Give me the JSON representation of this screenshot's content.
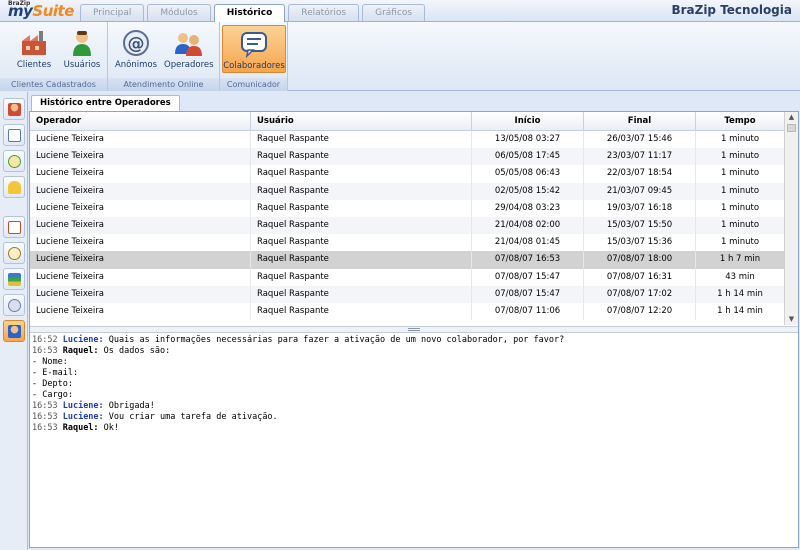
{
  "app": {
    "logo_brazip": "BraZip",
    "logo_my": "my",
    "logo_suite": "Suite",
    "brand": "BraZip Tecnologia"
  },
  "tabs": [
    {
      "label": "Principal",
      "active": false
    },
    {
      "label": "Módulos",
      "active": false
    },
    {
      "label": "Histórico",
      "active": true
    },
    {
      "label": "Relatórios",
      "active": false
    },
    {
      "label": "Gráficos",
      "active": false
    }
  ],
  "ribbon": {
    "groups": [
      {
        "label": "Clientes Cadastrados",
        "buttons": [
          {
            "label": "Clientes",
            "icon": "factory-icon"
          },
          {
            "label": "Usuários",
            "icon": "user-icon"
          }
        ]
      },
      {
        "label": "Atendimento Online",
        "buttons": [
          {
            "label": "Anônimos",
            "icon": "at-sign-icon"
          },
          {
            "label": "Operadores",
            "icon": "operators-icon"
          }
        ]
      },
      {
        "label": "Comunicador",
        "buttons": [
          {
            "label": "Colaboradores",
            "icon": "chat-bubble-icon",
            "active": true
          }
        ]
      }
    ]
  },
  "sidebar_icons": [
    "user-history-icon",
    "add-document-icon",
    "scheduled-add-icon",
    "bell-icon",
    "note-edit-icon",
    "clock-icon",
    "books-icon",
    "chat-users-icon",
    "collaborator-icon"
  ],
  "panel": {
    "tab_label": "Histórico entre Operadores"
  },
  "grid": {
    "columns": [
      "Operador",
      "Usuário",
      "Início",
      "Final",
      "Tempo"
    ],
    "rows": [
      [
        "Luciene Teixeira",
        "Raquel Raspante",
        "13/05/08 03:27",
        "26/03/07 15:46",
        "1 minuto"
      ],
      [
        "Luciene Teixeira",
        "Raquel Raspante",
        "06/05/08 17:45",
        "23/03/07 11:17",
        "1 minuto"
      ],
      [
        "Luciene Teixeira",
        "Raquel Raspante",
        "05/05/08 06:43",
        "22/03/07 18:54",
        "1 minuto"
      ],
      [
        "Luciene Teixeira",
        "Raquel Raspante",
        "02/05/08 15:42",
        "21/03/07 09:45",
        "1 minuto"
      ],
      [
        "Luciene Teixeira",
        "Raquel Raspante",
        "29/04/08 03:23",
        "19/03/07 16:18",
        "1 minuto"
      ],
      [
        "Luciene Teixeira",
        "Raquel Raspante",
        "21/04/08 02:00",
        "15/03/07 15:50",
        "1 minuto"
      ],
      [
        "Luciene Teixeira",
        "Raquel Raspante",
        "21/04/08 01:45",
        "15/03/07 15:36",
        "1 minuto"
      ],
      [
        "Luciene Teixeira",
        "Raquel Raspante",
        "07/08/07 16:53",
        "07/08/07 18:00",
        "1 h 7 min"
      ],
      [
        "Luciene Teixeira",
        "Raquel Raspante",
        "07/08/07 15:47",
        "07/08/07 16:31",
        "43 min"
      ],
      [
        "Luciene Teixeira",
        "Raquel Raspante",
        "07/08/07 15:47",
        "07/08/07 17:02",
        "1 h 14 min"
      ],
      [
        "Luciene Teixeira",
        "Raquel Raspante",
        "07/08/07 11:06",
        "07/08/07 12:20",
        "1 h 14 min"
      ]
    ],
    "selected_row": 7
  },
  "chat": [
    {
      "time": "16:52",
      "who": "Luciene:",
      "who_color": "blue",
      "text": "Quais as informações necessárias para fazer a ativação de um novo colaborador, por favor?"
    },
    {
      "time": "16:53",
      "who": "Raquel:",
      "who_color": "black",
      "text": "Os dados são:"
    },
    {
      "time": "",
      "who": "",
      "who_color": "black",
      "text": "- Nome:"
    },
    {
      "time": "",
      "who": "",
      "who_color": "black",
      "text": "- E-mail:"
    },
    {
      "time": "",
      "who": "",
      "who_color": "black",
      "text": "- Depto:"
    },
    {
      "time": "",
      "who": "",
      "who_color": "black",
      "text": "- Cargo:"
    },
    {
      "time": "16:53",
      "who": "Luciene:",
      "who_color": "blue",
      "text": "Obrigada!"
    },
    {
      "time": "16:53",
      "who": "Luciene:",
      "who_color": "blue",
      "text": "Vou criar uma tarefa de ativação."
    },
    {
      "time": "16:53",
      "who": "Raquel:",
      "who_color": "black",
      "text": "Ok!"
    }
  ]
}
